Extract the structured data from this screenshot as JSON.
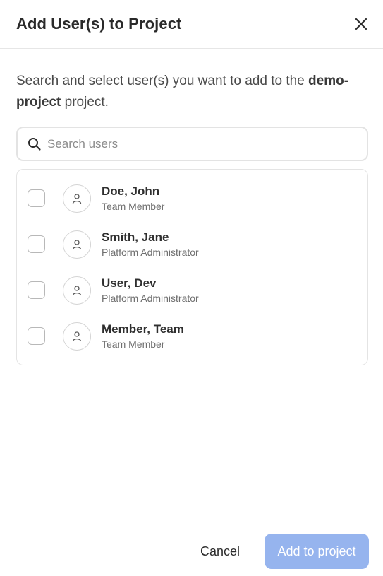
{
  "dialog": {
    "title": "Add User(s) to Project",
    "description_prefix": "Search and select user(s) you want to add to the ",
    "project_name": "demo-project",
    "description_suffix": " project."
  },
  "search": {
    "placeholder": "Search users",
    "value": "",
    "icon": "search-icon"
  },
  "users": [
    {
      "name": "Doe, John",
      "role": "Team Member",
      "checked": false
    },
    {
      "name": "Smith, Jane",
      "role": "Platform Administrator",
      "checked": false
    },
    {
      "name": "User, Dev",
      "role": "Platform Administrator",
      "checked": false
    },
    {
      "name": "Member, Team",
      "role": "Team Member",
      "checked": false
    }
  ],
  "footer": {
    "cancel_label": "Cancel",
    "add_label": "Add to project",
    "add_enabled": false
  },
  "colors": {
    "primary_disabled": "#96b4ee",
    "border": "#e4e4e4"
  }
}
